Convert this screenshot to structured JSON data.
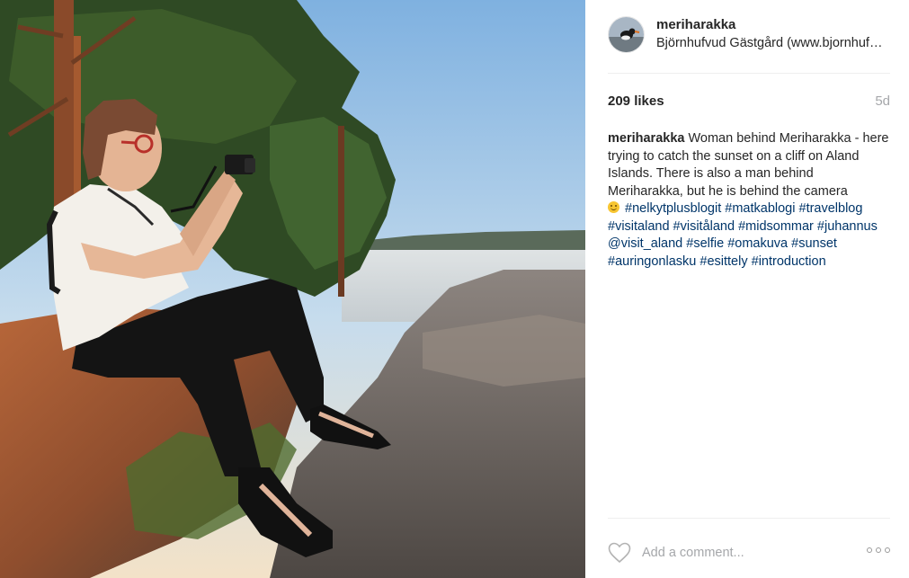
{
  "post": {
    "username": "meriharakka",
    "location": "Björnhufvud Gästgård (www.bjornhufvud.com)",
    "likes": "209 likes",
    "age": "5d"
  },
  "caption": {
    "user": "meriharakka",
    "text": "Woman behind Meriharakka - here trying to catch the sunset on a cliff on Aland Islands. There is also a man behind Meriharakka, but he is behind the camera",
    "emoji": "smiling-face-emoji",
    "tags": [
      "#nelkytplusblogit",
      "#matkablogi",
      "#travelblog",
      "#visitaland",
      "#visitåland",
      "#midsommar",
      "#juhannus",
      "@visit_aland",
      "#selfie",
      "#omakuva",
      "#sunset",
      "#auringonlasku",
      "#esittely",
      "#introduction"
    ]
  },
  "footer": {
    "comment_placeholder": "Add a comment...",
    "icons": [
      "heart-icon",
      "more-options-icon"
    ]
  },
  "colors": {
    "hashtag": "#003569",
    "muted": "#a5a7aa",
    "text": "#262626",
    "divider": "#efefef"
  }
}
